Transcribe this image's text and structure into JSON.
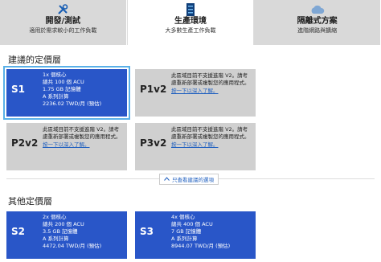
{
  "tabs": [
    {
      "title": "開發/測試",
      "sub": "適用於需求較小的工作負載",
      "icon": "tools-icon"
    },
    {
      "title": "生產環境",
      "sub": "大多數生產工作負載",
      "icon": "server-icon"
    },
    {
      "title": "隔離式方案",
      "sub": "進階網路與擴縮",
      "icon": "cloud-icon"
    }
  ],
  "recommended": {
    "title": "建議的定價層",
    "cards": [
      {
        "tier": "S1",
        "specs": [
          "1x 個核心",
          "總共 100 個 ACU",
          "1.75 GB 記憶體",
          "A 系列計算",
          "2236.02 TWD/月 (預估)"
        ]
      },
      {
        "tier": "P1v2",
        "note": "此區域目前不支援進階 V2。請考慮重新部署或複製您的應用程式。",
        "link": "按一下以深入了解。"
      },
      {
        "tier": "P2v2",
        "note": "此區域目前不支援進階 V2。請考慮重新部署或複製您的應用程式。",
        "link": "按一下以深入了解。"
      },
      {
        "tier": "P3v2",
        "note": "此區域目前不支援進階 V2。請考慮重新部署或複製您的應用程式。",
        "link": "按一下以深入了解。"
      }
    ],
    "show_more": "只查看建議的選項"
  },
  "other": {
    "title": "其他定價層",
    "cards": [
      {
        "tier": "S2",
        "specs": [
          "2x 個核心",
          "總共 200 個 ACU",
          "3.5 GB 記憶體",
          "A 系列計算",
          "4472.04 TWD/月 (預估)"
        ]
      },
      {
        "tier": "S3",
        "specs": [
          "4x 個核心",
          "總共 400 個 ACU",
          "7 GB 記憶體",
          "A 系列計算",
          "8944.07 TWD/月 (預估)"
        ]
      }
    ]
  }
}
